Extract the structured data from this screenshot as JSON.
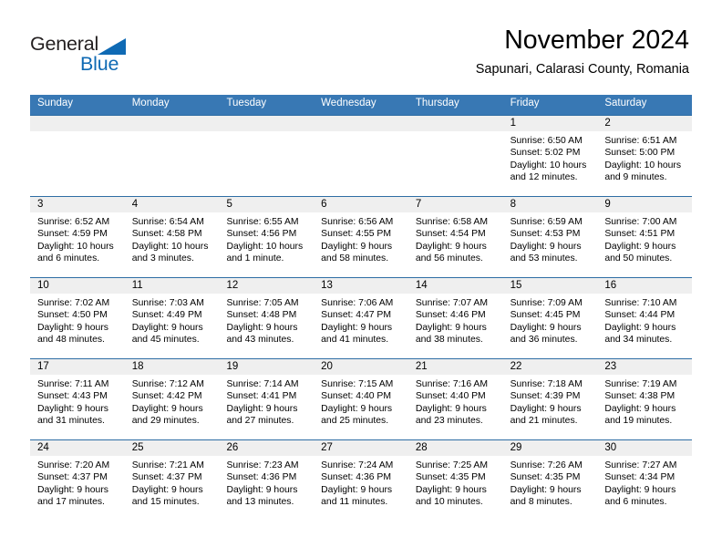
{
  "brand": {
    "name_top": "General",
    "name_bottom": "Blue",
    "triangle_color": "#0f6ab4"
  },
  "header": {
    "title": "November 2024",
    "subtitle": "Sapunari, Calarasi County, Romania"
  },
  "theme": {
    "header_blue": "#3878b4",
    "row_border": "#2e6da4",
    "daynum_band": "#efefef"
  },
  "calendar": {
    "weekday_headers": [
      "Sunday",
      "Monday",
      "Tuesday",
      "Wednesday",
      "Thursday",
      "Friday",
      "Saturday"
    ],
    "labels": {
      "sunrise": "Sunrise:",
      "sunset": "Sunset:",
      "daylight": "Daylight:"
    },
    "weeks": [
      [
        {
          "day": "",
          "empty": true
        },
        {
          "day": "",
          "empty": true
        },
        {
          "day": "",
          "empty": true
        },
        {
          "day": "",
          "empty": true
        },
        {
          "day": "",
          "empty": true
        },
        {
          "day": "1",
          "sunrise": "Sunrise: 6:50 AM",
          "sunset": "Sunset: 5:02 PM",
          "daylight": "Daylight: 10 hours and 12 minutes."
        },
        {
          "day": "2",
          "sunrise": "Sunrise: 6:51 AM",
          "sunset": "Sunset: 5:00 PM",
          "daylight": "Daylight: 10 hours and 9 minutes."
        }
      ],
      [
        {
          "day": "3",
          "sunrise": "Sunrise: 6:52 AM",
          "sunset": "Sunset: 4:59 PM",
          "daylight": "Daylight: 10 hours and 6 minutes."
        },
        {
          "day": "4",
          "sunrise": "Sunrise: 6:54 AM",
          "sunset": "Sunset: 4:58 PM",
          "daylight": "Daylight: 10 hours and 3 minutes."
        },
        {
          "day": "5",
          "sunrise": "Sunrise: 6:55 AM",
          "sunset": "Sunset: 4:56 PM",
          "daylight": "Daylight: 10 hours and 1 minute."
        },
        {
          "day": "6",
          "sunrise": "Sunrise: 6:56 AM",
          "sunset": "Sunset: 4:55 PM",
          "daylight": "Daylight: 9 hours and 58 minutes."
        },
        {
          "day": "7",
          "sunrise": "Sunrise: 6:58 AM",
          "sunset": "Sunset: 4:54 PM",
          "daylight": "Daylight: 9 hours and 56 minutes."
        },
        {
          "day": "8",
          "sunrise": "Sunrise: 6:59 AM",
          "sunset": "Sunset: 4:53 PM",
          "daylight": "Daylight: 9 hours and 53 minutes."
        },
        {
          "day": "9",
          "sunrise": "Sunrise: 7:00 AM",
          "sunset": "Sunset: 4:51 PM",
          "daylight": "Daylight: 9 hours and 50 minutes."
        }
      ],
      [
        {
          "day": "10",
          "sunrise": "Sunrise: 7:02 AM",
          "sunset": "Sunset: 4:50 PM",
          "daylight": "Daylight: 9 hours and 48 minutes."
        },
        {
          "day": "11",
          "sunrise": "Sunrise: 7:03 AM",
          "sunset": "Sunset: 4:49 PM",
          "daylight": "Daylight: 9 hours and 45 minutes."
        },
        {
          "day": "12",
          "sunrise": "Sunrise: 7:05 AM",
          "sunset": "Sunset: 4:48 PM",
          "daylight": "Daylight: 9 hours and 43 minutes."
        },
        {
          "day": "13",
          "sunrise": "Sunrise: 7:06 AM",
          "sunset": "Sunset: 4:47 PM",
          "daylight": "Daylight: 9 hours and 41 minutes."
        },
        {
          "day": "14",
          "sunrise": "Sunrise: 7:07 AM",
          "sunset": "Sunset: 4:46 PM",
          "daylight": "Daylight: 9 hours and 38 minutes."
        },
        {
          "day": "15",
          "sunrise": "Sunrise: 7:09 AM",
          "sunset": "Sunset: 4:45 PM",
          "daylight": "Daylight: 9 hours and 36 minutes."
        },
        {
          "day": "16",
          "sunrise": "Sunrise: 7:10 AM",
          "sunset": "Sunset: 4:44 PM",
          "daylight": "Daylight: 9 hours and 34 minutes."
        }
      ],
      [
        {
          "day": "17",
          "sunrise": "Sunrise: 7:11 AM",
          "sunset": "Sunset: 4:43 PM",
          "daylight": "Daylight: 9 hours and 31 minutes."
        },
        {
          "day": "18",
          "sunrise": "Sunrise: 7:12 AM",
          "sunset": "Sunset: 4:42 PM",
          "daylight": "Daylight: 9 hours and 29 minutes."
        },
        {
          "day": "19",
          "sunrise": "Sunrise: 7:14 AM",
          "sunset": "Sunset: 4:41 PM",
          "daylight": "Daylight: 9 hours and 27 minutes."
        },
        {
          "day": "20",
          "sunrise": "Sunrise: 7:15 AM",
          "sunset": "Sunset: 4:40 PM",
          "daylight": "Daylight: 9 hours and 25 minutes."
        },
        {
          "day": "21",
          "sunrise": "Sunrise: 7:16 AM",
          "sunset": "Sunset: 4:40 PM",
          "daylight": "Daylight: 9 hours and 23 minutes."
        },
        {
          "day": "22",
          "sunrise": "Sunrise: 7:18 AM",
          "sunset": "Sunset: 4:39 PM",
          "daylight": "Daylight: 9 hours and 21 minutes."
        },
        {
          "day": "23",
          "sunrise": "Sunrise: 7:19 AM",
          "sunset": "Sunset: 4:38 PM",
          "daylight": "Daylight: 9 hours and 19 minutes."
        }
      ],
      [
        {
          "day": "24",
          "sunrise": "Sunrise: 7:20 AM",
          "sunset": "Sunset: 4:37 PM",
          "daylight": "Daylight: 9 hours and 17 minutes."
        },
        {
          "day": "25",
          "sunrise": "Sunrise: 7:21 AM",
          "sunset": "Sunset: 4:37 PM",
          "daylight": "Daylight: 9 hours and 15 minutes."
        },
        {
          "day": "26",
          "sunrise": "Sunrise: 7:23 AM",
          "sunset": "Sunset: 4:36 PM",
          "daylight": "Daylight: 9 hours and 13 minutes."
        },
        {
          "day": "27",
          "sunrise": "Sunrise: 7:24 AM",
          "sunset": "Sunset: 4:36 PM",
          "daylight": "Daylight: 9 hours and 11 minutes."
        },
        {
          "day": "28",
          "sunrise": "Sunrise: 7:25 AM",
          "sunset": "Sunset: 4:35 PM",
          "daylight": "Daylight: 9 hours and 10 minutes."
        },
        {
          "day": "29",
          "sunrise": "Sunrise: 7:26 AM",
          "sunset": "Sunset: 4:35 PM",
          "daylight": "Daylight: 9 hours and 8 minutes."
        },
        {
          "day": "30",
          "sunrise": "Sunrise: 7:27 AM",
          "sunset": "Sunset: 4:34 PM",
          "daylight": "Daylight: 9 hours and 6 minutes."
        }
      ]
    ]
  }
}
